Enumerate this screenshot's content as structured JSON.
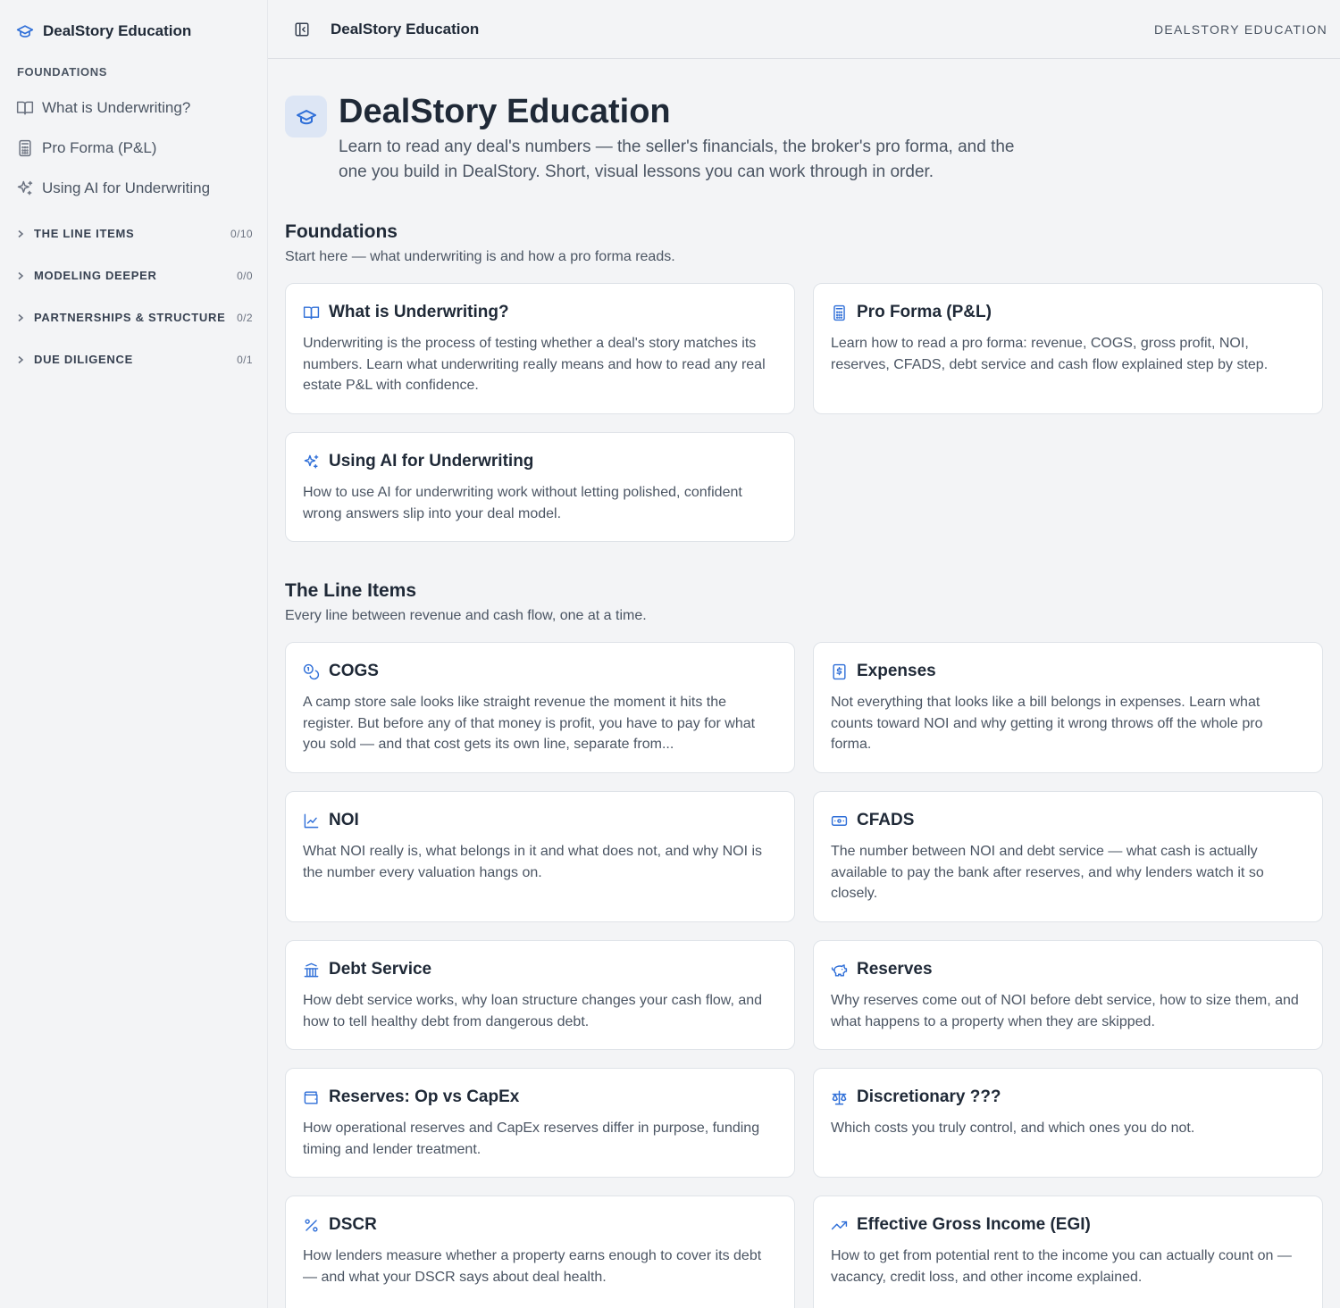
{
  "sidebar": {
    "brand": "DealStory Education",
    "section_label": "FOUNDATIONS",
    "items": [
      {
        "label": "What is Underwriting?",
        "icon": "book-icon"
      },
      {
        "label": "Pro Forma (P&L)",
        "icon": "calculator-icon"
      },
      {
        "label": "Using AI for Underwriting",
        "icon": "sparkles-icon"
      }
    ],
    "groups": [
      {
        "label": "THE LINE ITEMS",
        "count": "0/10"
      },
      {
        "label": "MODELING DEEPER",
        "count": "0/0"
      },
      {
        "label": "PARTNERSHIPS & STRUCTURE",
        "count": "0/2"
      },
      {
        "label": "DUE DILIGENCE",
        "count": "0/1"
      }
    ]
  },
  "topbar": {
    "title": "DealStory Education",
    "right_label": "DEALSTORY EDUCATION"
  },
  "hero": {
    "title": "DealStory Education",
    "subtitle": "Learn to read any deal's numbers — the seller's financials, the broker's pro forma, and the one you build in DealStory. Short, visual lessons you can work through in order."
  },
  "sections": [
    {
      "title": "Foundations",
      "subtitle": "Start here — what underwriting is and how a pro forma reads.",
      "cards": [
        {
          "title": "What is Underwriting?",
          "icon": "book-icon",
          "desc": "Underwriting is the process of testing whether a deal's story matches its numbers. Learn what underwriting really means and how to read any real estate P&L with confidence."
        },
        {
          "title": "Pro Forma (P&L)",
          "icon": "calculator-icon",
          "desc": "Learn how to read a pro forma: revenue, COGS, gross profit, NOI, reserves, CFADS, debt service and cash flow explained step by step."
        },
        {
          "title": "Using AI for Underwriting",
          "icon": "sparkles-icon",
          "desc": "How to use AI for underwriting work without letting polished, confident wrong answers slip into your deal model."
        }
      ]
    },
    {
      "title": "The Line Items",
      "subtitle": "Every line between revenue and cash flow, one at a time.",
      "cards": [
        {
          "title": "COGS",
          "icon": "coins-icon",
          "desc": "A camp store sale looks like straight revenue the moment it hits the register. But before any of that money is profit, you have to pay for what you sold — and that cost gets its own line, separate from..."
        },
        {
          "title": "Expenses",
          "icon": "receipt-icon",
          "desc": "Not everything that looks like a bill belongs in expenses. Learn what counts toward NOI and why getting it wrong throws off the whole pro forma."
        },
        {
          "title": "NOI",
          "icon": "line-chart-icon",
          "desc": "What NOI really is, what belongs in it and what does not, and why NOI is the number every valuation hangs on."
        },
        {
          "title": "CFADS",
          "icon": "banknote-icon",
          "desc": "The number between NOI and debt service — what cash is actually available to pay the bank after reserves, and why lenders watch it so closely."
        },
        {
          "title": "Debt Service",
          "icon": "bank-icon",
          "desc": "How debt service works, why loan structure changes your cash flow, and how to tell healthy debt from dangerous debt."
        },
        {
          "title": "Reserves",
          "icon": "piggy-bank-icon",
          "desc": "Why reserves come out of NOI before debt service, how to size them, and what happens to a property when they are skipped."
        },
        {
          "title": "Reserves: Op vs CapEx",
          "icon": "wallet-icon",
          "desc": "How operational reserves and CapEx reserves differ in purpose, funding timing and lender treatment."
        },
        {
          "title": "Discretionary ???",
          "icon": "scale-icon",
          "desc": "Which costs you truly control, and which ones you do not."
        },
        {
          "title": "DSCR",
          "icon": "percent-icon",
          "desc": "How lenders measure whether a property earns enough to cover its debt — and what your DSCR says about deal health."
        },
        {
          "title": "Effective Gross Income (EGI)",
          "icon": "trending-up-icon",
          "desc": "How to get from potential rent to the income you can actually count on — vacancy, credit loss, and other income explained."
        }
      ]
    }
  ]
}
